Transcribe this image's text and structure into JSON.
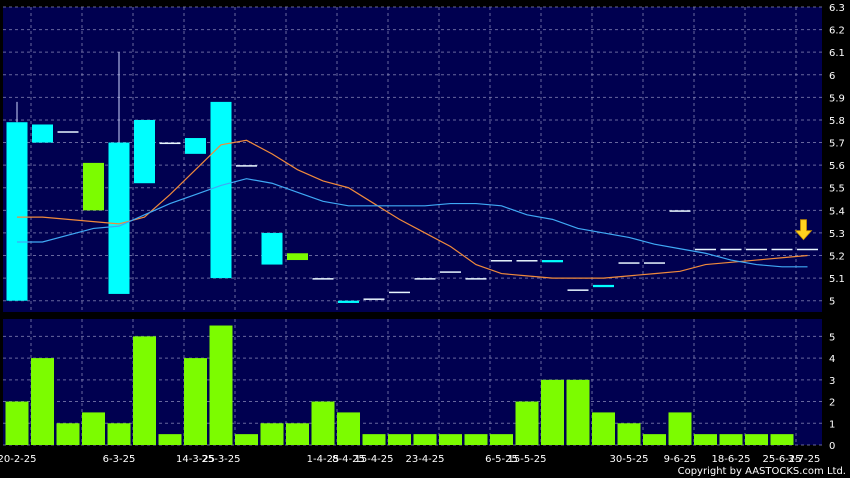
{
  "colors": {
    "background": "#000000",
    "panel": "#000050",
    "grid": "#8a8ab8",
    "candle_up": "#7CFC00",
    "candle_down": "#00FFFF",
    "ma_short": "#f08a3c",
    "ma_long": "#3fa9f5",
    "volume": "#7CFC00",
    "arrow": "#ffd21f",
    "text": "#ffffff"
  },
  "copyright": "Copyright by AASTOCKS.com Ltd.",
  "chart_data": [
    {
      "type": "candlestick",
      "title": "",
      "ylim": [
        4.95,
        6.3
      ],
      "y_ticks": [
        "5",
        "5.1",
        "5.2",
        "5.3",
        "5.4",
        "5.5",
        "5.6",
        "5.7",
        "5.8",
        "5.9",
        "6",
        "6.1",
        "6.2",
        "6.3"
      ],
      "series": [
        {
          "kind": "ohlc",
          "values": [
            {
              "o": 5.79,
              "h": 5.88,
              "l": 5.0,
              "c": 5.0
            },
            {
              "o": 5.78,
              "h": 5.78,
              "l": 5.7,
              "c": 5.7
            },
            {
              "o": 5.75,
              "h": 5.75,
              "l": 5.75,
              "c": 5.75
            },
            {
              "o": 5.4,
              "h": 5.61,
              "l": 5.4,
              "c": 5.61
            },
            {
              "o": 5.7,
              "h": 6.1,
              "l": 5.03,
              "c": 5.03
            },
            {
              "o": 5.8,
              "h": 5.8,
              "l": 5.52,
              "c": 5.52
            },
            {
              "o": 5.7,
              "h": 5.7,
              "l": 5.7,
              "c": 5.7
            },
            {
              "o": 5.72,
              "h": 5.72,
              "l": 5.65,
              "c": 5.65
            },
            {
              "o": 5.88,
              "h": 5.88,
              "l": 5.1,
              "c": 5.1
            },
            {
              "o": 5.6,
              "h": 5.6,
              "l": 5.6,
              "c": 5.6
            },
            {
              "o": 5.3,
              "h": 5.3,
              "l": 5.16,
              "c": 5.16
            },
            {
              "o": 5.18,
              "h": 5.21,
              "l": 5.18,
              "c": 5.21
            },
            {
              "o": 5.1,
              "h": 5.1,
              "l": 5.1,
              "c": 5.1
            },
            {
              "o": 5.0,
              "h": 5.0,
              "l": 4.99,
              "c": 4.99
            },
            {
              "o": 5.01,
              "h": 5.01,
              "l": 5.01,
              "c": 5.01
            },
            {
              "o": 5.04,
              "h": 5.04,
              "l": 5.04,
              "c": 5.04
            },
            {
              "o": 5.1,
              "h": 5.1,
              "l": 5.1,
              "c": 5.1
            },
            {
              "o": 5.13,
              "h": 5.13,
              "l": 5.13,
              "c": 5.13
            },
            {
              "o": 5.1,
              "h": 5.1,
              "l": 5.1,
              "c": 5.1
            },
            {
              "o": 5.18,
              "h": 5.18,
              "l": 5.18,
              "c": 5.18
            },
            {
              "o": 5.18,
              "h": 5.18,
              "l": 5.18,
              "c": 5.18
            },
            {
              "o": 5.18,
              "h": 5.18,
              "l": 5.17,
              "c": 5.17
            },
            {
              "o": 5.05,
              "h": 5.05,
              "l": 5.05,
              "c": 5.05
            },
            {
              "o": 5.07,
              "h": 5.07,
              "l": 5.06,
              "c": 5.06
            },
            {
              "o": 5.17,
              "h": 5.17,
              "l": 5.17,
              "c": 5.17
            },
            {
              "o": 5.17,
              "h": 5.17,
              "l": 5.17,
              "c": 5.17
            },
            {
              "o": 5.4,
              "h": 5.4,
              "l": 5.4,
              "c": 5.4
            },
            {
              "o": 5.23,
              "h": 5.23,
              "l": 5.23,
              "c": 5.23
            },
            {
              "o": 5.23,
              "h": 5.23,
              "l": 5.23,
              "c": 5.23
            },
            {
              "o": 5.23,
              "h": 5.23,
              "l": 5.23,
              "c": 5.23
            },
            {
              "o": 5.23,
              "h": 5.23,
              "l": 5.23,
              "c": 5.23
            },
            {
              "o": 5.23,
              "h": 5.23,
              "l": 5.23,
              "c": 5.23
            }
          ]
        },
        {
          "kind": "line",
          "color_key": "ma_short",
          "values": [
            5.37,
            5.37,
            5.36,
            5.35,
            5.34,
            5.37,
            5.47,
            5.58,
            5.69,
            5.71,
            5.65,
            5.58,
            5.53,
            5.5,
            5.43,
            5.36,
            5.3,
            5.24,
            5.16,
            5.12,
            5.11,
            5.1,
            5.1,
            5.1,
            5.11,
            5.12,
            5.13,
            5.16,
            5.17,
            5.18,
            5.19,
            5.2
          ]
        },
        {
          "kind": "line",
          "color_key": "ma_long",
          "values": [
            5.26,
            5.26,
            5.29,
            5.32,
            5.33,
            5.38,
            5.43,
            5.47,
            5.51,
            5.54,
            5.52,
            5.48,
            5.44,
            5.42,
            5.42,
            5.42,
            5.42,
            5.43,
            5.43,
            5.42,
            5.38,
            5.36,
            5.32,
            5.3,
            5.28,
            5.25,
            5.23,
            5.21,
            5.18,
            5.16,
            5.15,
            5.15
          ]
        }
      ],
      "arrow_marker": {
        "index": 31,
        "value": 5.27
      }
    },
    {
      "type": "bar",
      "title": "",
      "ylim": [
        0,
        5.8
      ],
      "y_ticks": [
        "0",
        "1",
        "2",
        "3",
        "4",
        "5"
      ],
      "values": [
        2,
        4,
        1,
        1.5,
        1,
        5,
        0.5,
        4,
        5.5,
        0.5,
        1,
        1,
        2,
        1.5,
        0.5,
        0.5,
        0.5,
        0.5,
        0.5,
        0.5,
        2,
        3,
        3,
        1.5,
        1,
        0.5,
        1.5,
        0.5,
        0.5,
        0.5,
        0.5
      ],
      "x_tick_labels": [
        {
          "index": 0,
          "label": "20-2-25"
        },
        {
          "index": 4,
          "label": "6-3-25"
        },
        {
          "index": 7,
          "label": "14-3-25"
        },
        {
          "index": 8,
          "label": "25-3-25"
        },
        {
          "index": 12,
          "label": "1-4-25"
        },
        {
          "index": 13,
          "label": "8-4-25"
        },
        {
          "index": 14,
          "label": "15-4-25"
        },
        {
          "index": 16,
          "label": "23-4-25"
        },
        {
          "index": 19,
          "label": "6-5-25"
        },
        {
          "index": 20,
          "label": "15-5-25"
        },
        {
          "index": 24,
          "label": "30-5-25"
        },
        {
          "index": 26,
          "label": "9-6-25"
        },
        {
          "index": 28,
          "label": "18-6-25"
        },
        {
          "index": 30,
          "label": "25-6-25"
        },
        {
          "index": 31,
          "label": "3-7-25"
        }
      ]
    }
  ]
}
